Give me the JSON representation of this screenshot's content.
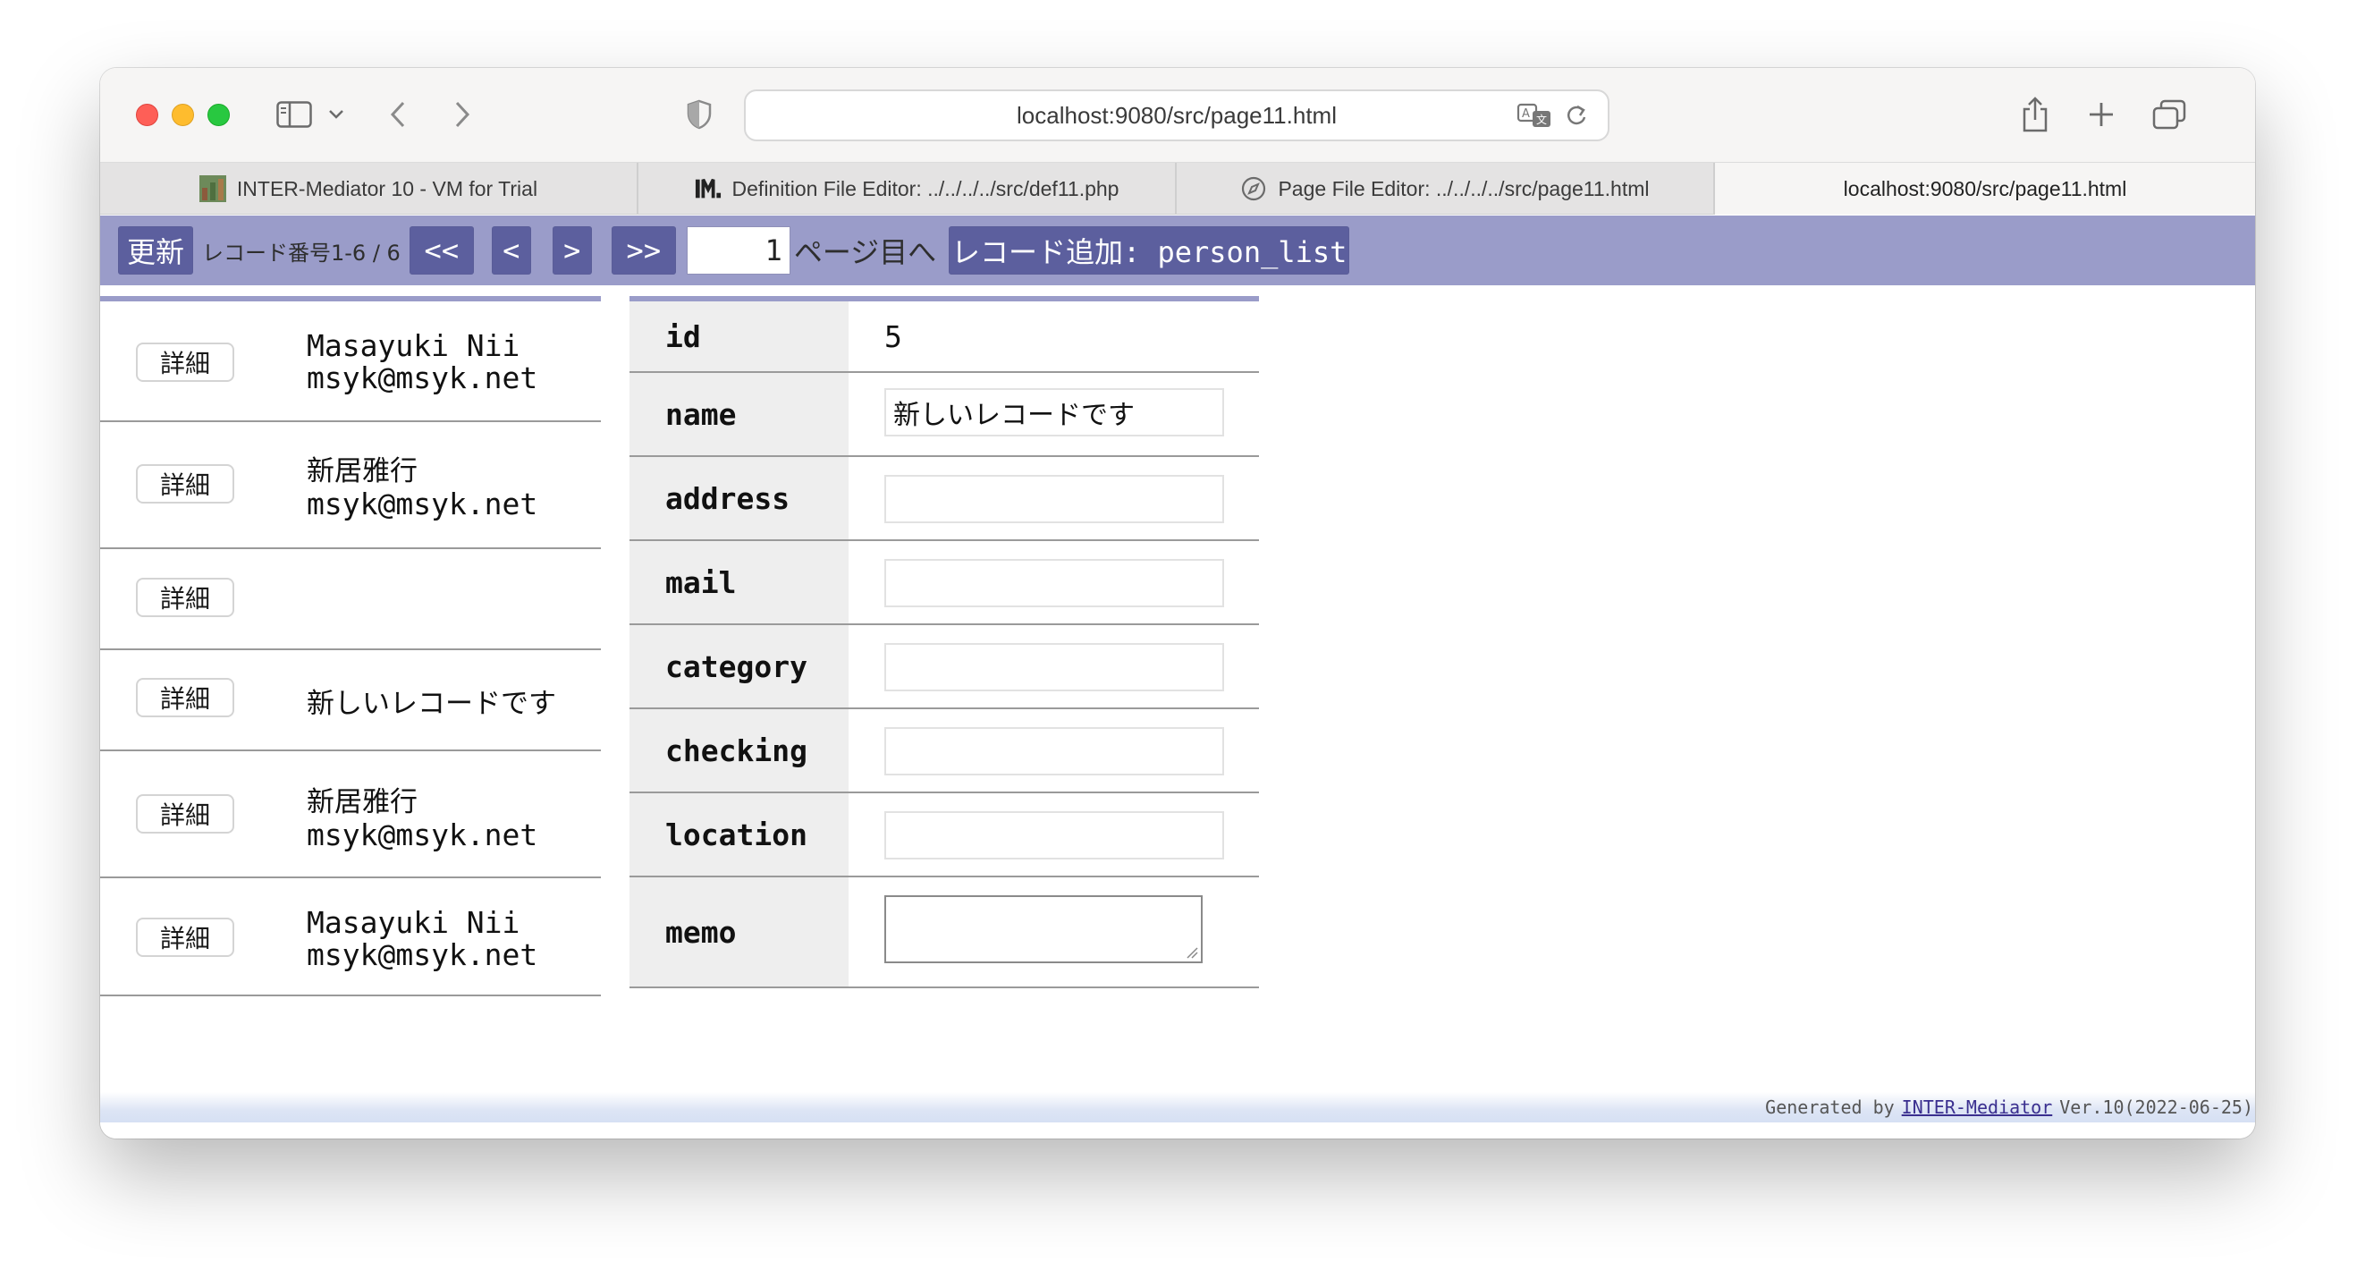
{
  "browser": {
    "url": "localhost:9080/src/page11.html",
    "tabs": [
      {
        "label": "INTER-Mediator 10 - VM for Trial",
        "icon": "app-favicon-icon"
      },
      {
        "label": "Definition File Editor: ../../../../src/def11.php",
        "icon": "im-logo-icon"
      },
      {
        "label": "Page File Editor: ../../../../src/page11.html",
        "icon": "compass-icon"
      },
      {
        "label": "localhost:9080/src/page11.html",
        "icon": ""
      }
    ]
  },
  "navbar": {
    "refresh_label": "更新",
    "record_info": "レコード番号1-6 / 6",
    "first_label": "<<",
    "prev_label": "<",
    "next_label": ">",
    "last_label": ">>",
    "page_value": "1",
    "page_suffix": "ページ目へ",
    "add_record_label": "レコード追加: person_list"
  },
  "list": {
    "detail_label": "詳細",
    "rows": [
      {
        "name": "Masayuki Nii",
        "mail": "msyk@msyk.net"
      },
      {
        "name": "新居雅行",
        "mail": "msyk@msyk.net"
      },
      {
        "name": "",
        "mail": ""
      },
      {
        "name": "新しいレコードです",
        "mail": ""
      },
      {
        "name": "新居雅行",
        "mail": "msyk@msyk.net"
      },
      {
        "name": "Masayuki Nii",
        "mail": "msyk@msyk.net"
      }
    ]
  },
  "detail": {
    "fields": [
      {
        "label": "id",
        "value": "5"
      },
      {
        "label": "name",
        "value": "新しいレコードです"
      },
      {
        "label": "address",
        "value": ""
      },
      {
        "label": "mail",
        "value": ""
      },
      {
        "label": "category",
        "value": ""
      },
      {
        "label": "checking",
        "value": ""
      },
      {
        "label": "location",
        "value": ""
      },
      {
        "label": "memo",
        "value": ""
      }
    ]
  },
  "footer": {
    "prefix": "Generated by",
    "link": "INTER-Mediator",
    "version": "Ver.10(2022-06-25)"
  }
}
